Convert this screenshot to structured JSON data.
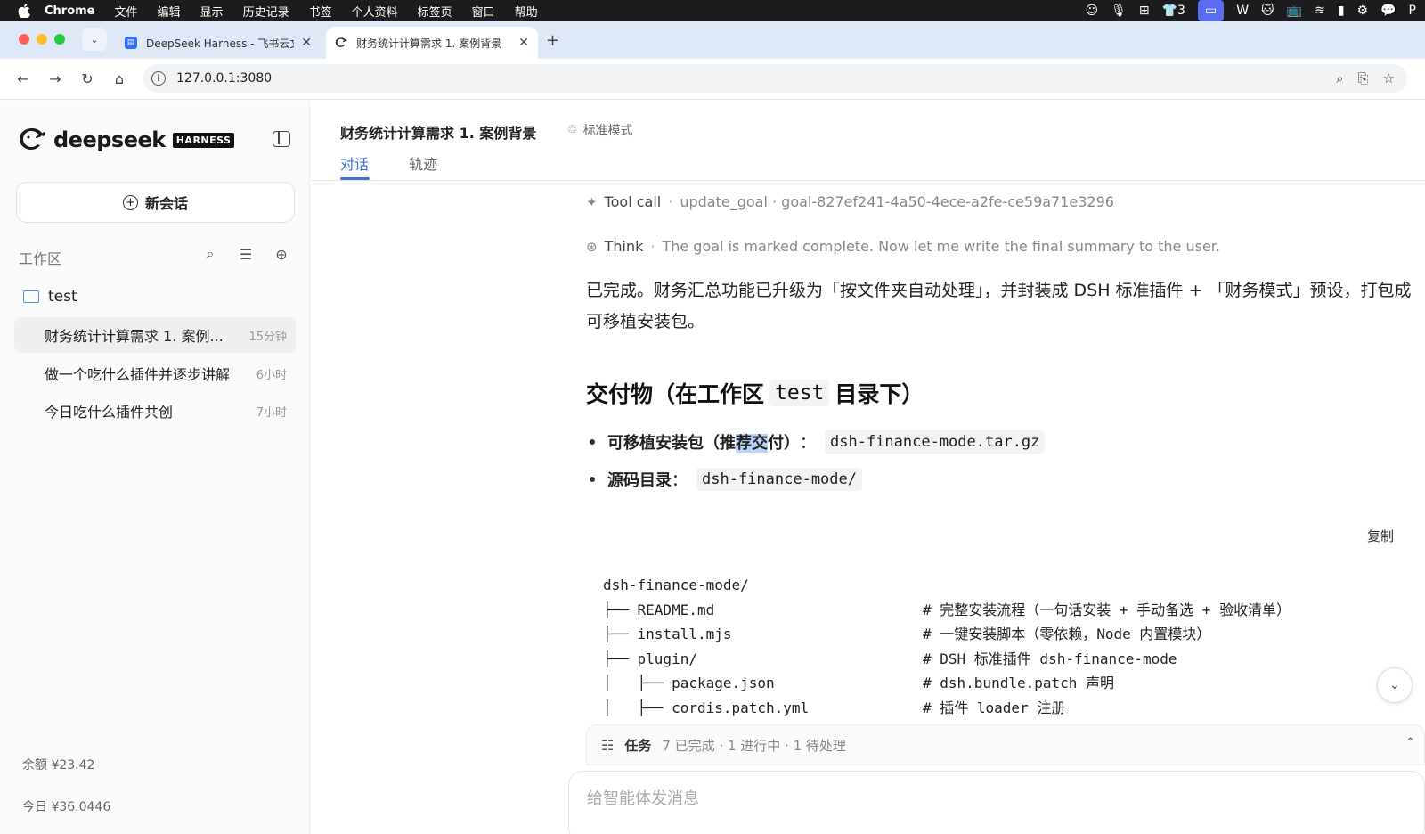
{
  "menubar": {
    "items": [
      "Chrome",
      "文件",
      "编辑",
      "显示",
      "历史记录",
      "书签",
      "个人资料",
      "标签页",
      "窗口",
      "帮助"
    ],
    "badge_count": "3"
  },
  "browser": {
    "tabs": [
      {
        "title": "DeepSeek Harness - 飞书云文"
      },
      {
        "title": "财务统计计算需求 1. 案例背景"
      }
    ],
    "address": "127.0.0.1:3080"
  },
  "sidebar": {
    "brand": "deepseek",
    "brand_badge": "HARNESS",
    "new_chat": "新会话",
    "workspace_label": "工作区",
    "folder": "test",
    "conversations": [
      {
        "title": "财务统计计算需求 1. 案例...",
        "time": "15分钟"
      },
      {
        "title": "做一个吃什么插件并逐步讲解",
        "time": "6小时"
      },
      {
        "title": "今日吃什么插件共创",
        "time": "7小时"
      }
    ],
    "balance": "余额 ¥23.42",
    "today": "今日 ¥36.0446"
  },
  "main": {
    "title": "财务统计计算需求 1. 案例背景",
    "mode": "标准模式",
    "tabs": [
      "对话",
      "轨迹"
    ],
    "tool_call": {
      "label": "Tool call",
      "value": "update_goal · goal-827ef241-4a50-4ece-a2fe-ce59a71e3296"
    },
    "think": {
      "label": "Think",
      "value": "The goal is marked complete. Now let me write the final summary to the user."
    },
    "paragraph": "已完成。财务汇总功能已升级为「按文件夹自动处理」，并封装成 DSH 标准插件 + 「财务模式」预设，打包成可移植安装包。",
    "heading_before": "交付物（在工作区",
    "heading_code": "test",
    "heading_after": "目录下）",
    "bullets": [
      {
        "label_a": "可移植安装包（推",
        "label_hl": "荐交",
        "label_b": "付）",
        "code": "dsh-finance-mode.tar.gz"
      },
      {
        "label": "源码目录",
        "code": "dsh-finance-mode/"
      }
    ],
    "copy_label": "复制",
    "code_lines": [
      {
        "code": "dsh-finance-mode/",
        "comment": ""
      },
      {
        "code": "├── README.md",
        "comment": "# 完整安装流程（一句话安装 + 手动备选 + 验收清单）"
      },
      {
        "code": "├── install.mjs",
        "comment": "# 一键安装脚本（零依赖，Node 内置模块）"
      },
      {
        "code": "├── plugin/",
        "comment": "# DSH 标准插件 dsh-finance-mode"
      },
      {
        "code": "│   ├── package.json",
        "comment": "# dsh.bundle.patch 声明"
      },
      {
        "code": "│   ├── cordis.patch.yml",
        "comment": "# 插件 loader 注册"
      }
    ],
    "tasks": {
      "label": "任务",
      "summary": "7 已完成 · 1 进行中 · 1 待处理"
    },
    "composer_placeholder": "给智能体发消息"
  }
}
